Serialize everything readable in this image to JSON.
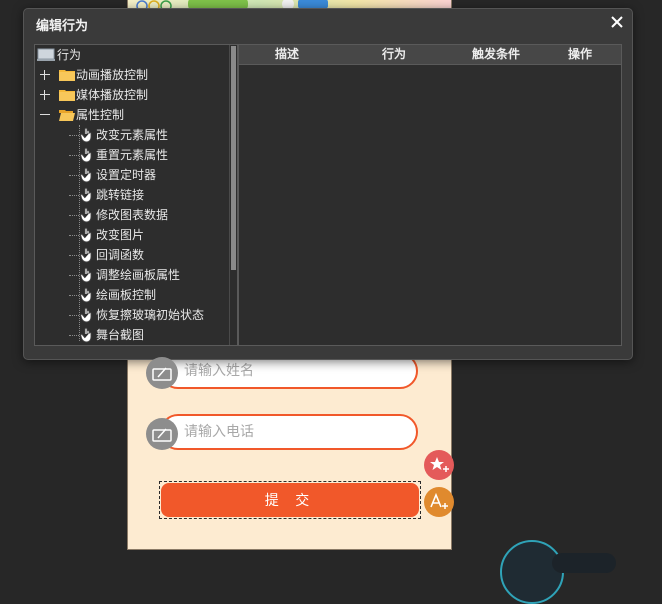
{
  "dialog": {
    "title": "编辑行为",
    "close_glyph": "✕"
  },
  "tree": {
    "root_label": "行为",
    "groups": [
      {
        "label": "动画播放控制",
        "expanded": false
      },
      {
        "label": "媒体播放控制",
        "expanded": false
      },
      {
        "label": "属性控制",
        "expanded": true
      }
    ],
    "items": [
      "改变元素属性",
      "重置元素属性",
      "设置定时器",
      "跳转链接",
      "修改图表数据",
      "改变图片",
      "回调函数",
      "调整绘画板属性",
      "绘画板控制",
      "恢复擦玻璃初始状态",
      "舞台截图"
    ]
  },
  "table": {
    "columns": [
      "描述",
      "行为",
      "触发条件",
      "操作"
    ]
  },
  "form": {
    "name_placeholder": "请输入姓名",
    "phone_placeholder": "请输入电话",
    "submit_label": "提 交"
  },
  "colors": {
    "accent": "#f1582a",
    "canvas_bg": "#fdebd1",
    "dialog_bg": "#3a3a3a"
  },
  "icons": {
    "field": "input-field-icon",
    "float_1": "star-add-icon",
    "float_2": "text-add-icon"
  }
}
